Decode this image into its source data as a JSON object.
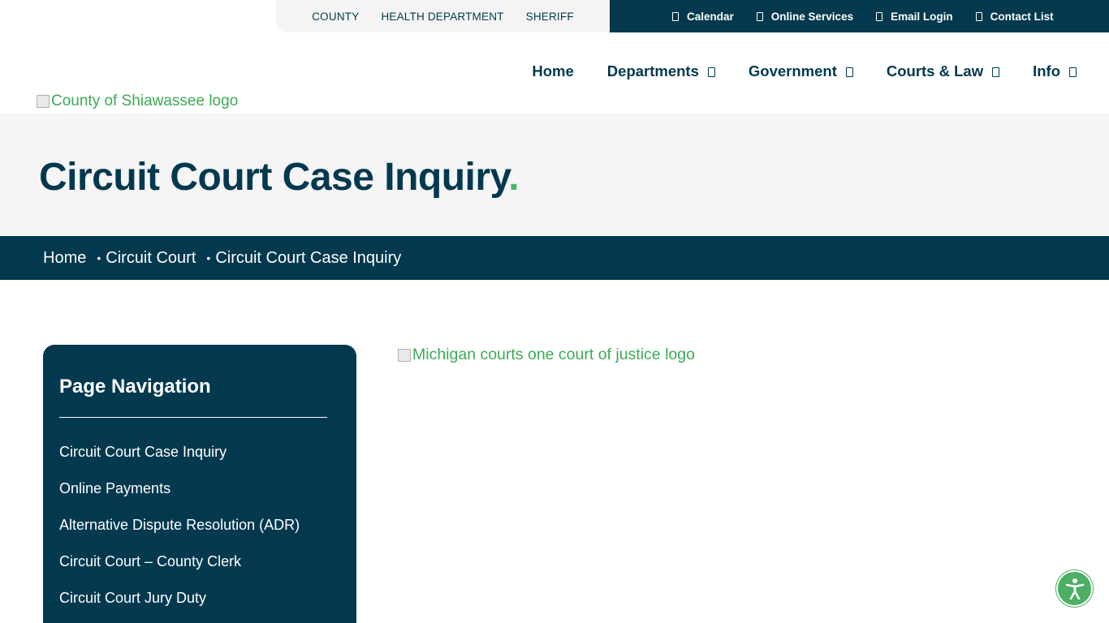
{
  "site_links": [
    "COUNTY",
    "HEALTH DEPARTMENT",
    "SHERIFF"
  ],
  "utility_links": [
    {
      "label": "Calendar",
      "icon": "calendar-icon"
    },
    {
      "label": "Online Services",
      "icon": "online-services-icon"
    },
    {
      "label": "Email Login",
      "icon": "email-icon"
    },
    {
      "label": "Contact List",
      "icon": "contact-list-icon"
    }
  ],
  "nav": {
    "home": "Home",
    "departments": "Departments",
    "government": "Government",
    "courts": "Courts & Law",
    "info": "Info"
  },
  "logo_alt": "County of Shiawassee logo",
  "page": {
    "title": "Circuit Court Case Inquiry",
    "title_dot": "."
  },
  "breadcrumb": {
    "home": "Home",
    "parent": "Circuit Court",
    "current": "Circuit Court Case Inquiry"
  },
  "sidebar": {
    "heading": "Page Navigation",
    "items": [
      "Circuit Court Case Inquiry",
      "Online Payments",
      "Alternative Dispute Resolution (ADR)",
      "Circuit Court – County Clerk",
      "Circuit Court Jury Duty"
    ]
  },
  "content_image_alt": "Michigan courts one court of justice logo",
  "colors": {
    "navy": "#02394f",
    "accent_green": "#3dbb5e",
    "link_green": "#3daa55",
    "light_bg": "#f5f5f5"
  }
}
